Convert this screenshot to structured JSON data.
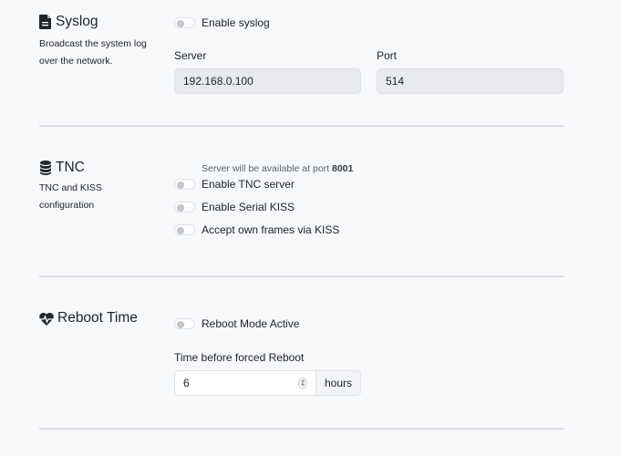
{
  "syslog": {
    "title": "Syslog",
    "icon": "file-text-icon",
    "description": "Broadcast the system log over the network.",
    "enable_label": "Enable syslog",
    "enabled": false,
    "server_label": "Server",
    "server_value": "192.168.0.100",
    "port_label": "Port",
    "port_value": "514"
  },
  "tnc": {
    "title": "TNC",
    "icon": "database-icon",
    "description": "TNC and KISS configuration",
    "hint_prefix": "Server will be available at port",
    "hint_port": "8001",
    "toggles": [
      {
        "label": "Enable TNC server",
        "enabled": false
      },
      {
        "label": "Enable Serial KISS",
        "enabled": false
      },
      {
        "label": "Accept own frames via KISS",
        "enabled": false
      }
    ]
  },
  "reboot": {
    "title": "Reboot Time",
    "icon": "heart-pulse-icon",
    "toggle_label": "Reboot Mode Active",
    "enabled": false,
    "time_label": "Time before forced Reboot",
    "time_value": "6",
    "time_unit": "hours"
  }
}
